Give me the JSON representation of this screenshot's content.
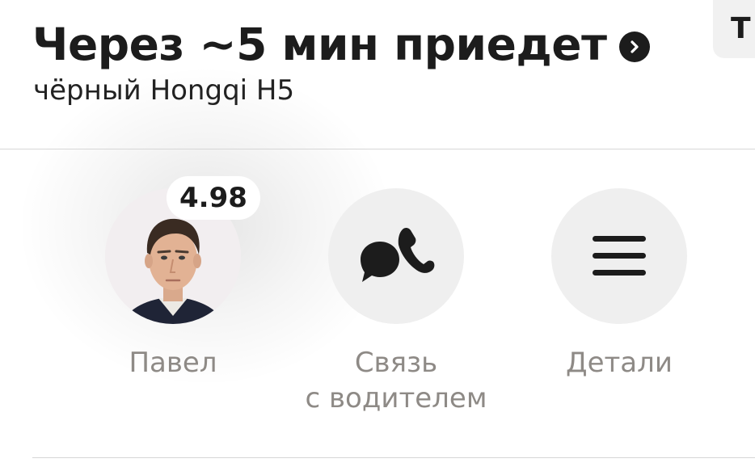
{
  "header": {
    "title": "Через ~5 мин приедет",
    "subtitle": "чёрный Hongqi H5",
    "corner_tab_text": "Т"
  },
  "driver": {
    "name": "Павел",
    "rating": "4.98"
  },
  "actions": [
    {
      "label_line1": "Связь",
      "label_line2": "с водителем",
      "icon": "chat-phone-icon"
    },
    {
      "label": "Детали",
      "icon": "menu-icon"
    }
  ],
  "colors": {
    "text_primary": "#1c1c1c",
    "text_secondary": "#8e8a86",
    "circle_bg": "#efefef",
    "divider": "#d6d6d6"
  }
}
